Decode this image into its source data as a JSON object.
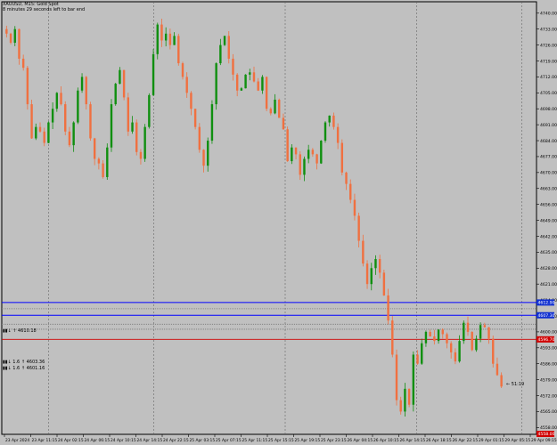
{
  "header": {
    "symbol_line": "XAUUSD, M15: Gold Spot",
    "timer_line": "8 minutes 29 seconds left to bar end"
  },
  "annotations": {
    "hline_label_1": "▮▮↓ ↑ 4610.18",
    "hline_label_2": "▮▮↓ 1.6 ↑ 4603.36",
    "hline_label_3": "▮▮↓ 1.6 ↑ 4601.16",
    "countdown": "← 51:19"
  },
  "colors": {
    "background": "#c0c0c0",
    "bull_candle": "#0f8f0f",
    "bear_candle": "#f07040",
    "grid": "#666666",
    "blue_line": "#0000ff",
    "red_line": "#d00000",
    "current_price_tag": "#d00000",
    "blue_price_tag": "#1030d0"
  },
  "chart_data": {
    "type": "candlestick",
    "symbol": "XAUUSD",
    "timeframe": "M15",
    "y_axis_ticks": [
      "4740.00",
      "4733.00",
      "4726.00",
      "4719.00",
      "4712.00",
      "4705.00",
      "4698.00",
      "4691.00",
      "4684.00",
      "4677.00",
      "4670.00",
      "4663.00",
      "4656.00",
      "4649.00",
      "4642.00",
      "4635.00",
      "4628.00",
      "4621.00",
      "4614.00",
      "4607.00",
      "4600.00",
      "4593.00",
      "4586.00",
      "4579.00",
      "4572.00",
      "4565.00",
      "4558.00"
    ],
    "x_axis_ticks": [
      "23 Apr 2024",
      "23 Apr 11:15",
      "24 Apr 02:15",
      "24 Apr 06:15",
      "24 Apr 10:15",
      "24 Apr 14:15",
      "24 Apr 22:15",
      "25 Apr 03:15",
      "25 Apr 07:15",
      "25 Apr 11:15",
      "25 Apr 15:15",
      "25 Apr 19:15",
      "25 Apr 23:15",
      "26 Apr 04:15",
      "26 Apr 10:15",
      "26 Apr 14:15",
      "26 Apr 18:15",
      "26 Apr 22:15",
      "29 Apr 01:15",
      "29 Apr 05:15",
      "29 Apr 09:15"
    ],
    "y_range": [
      4555,
      4745
    ],
    "candles_close_path": [
      4731,
      4727,
      4733,
      4720,
      4716,
      4700,
      4685,
      4690,
      4688,
      4683,
      4692,
      4698,
      4705,
      4700,
      4688,
      4682,
      4692,
      4706,
      4712,
      4700,
      4685,
      4676,
      4674,
      4668,
      4681,
      4700,
      4709,
      4715,
      4703,
      4688,
      4692,
      4679,
      4676,
      4690,
      4704,
      4722,
      4735,
      4728,
      4731,
      4726,
      4730,
      4718,
      4712,
      4705,
      4698,
      4690,
      4680,
      4673,
      4684,
      4700,
      4718,
      4726,
      4730,
      4720,
      4713,
      4706,
      4707,
      4713,
      4714,
      4710,
      4706,
      4712,
      4698,
      4696,
      4702,
      4694,
      4689,
      4675,
      4681,
      4678,
      4669,
      4676,
      4680,
      4678,
      4674,
      4684,
      4692,
      4695,
      4690,
      4683,
      4670,
      4665,
      4658,
      4651,
      4640,
      4630,
      4621,
      4628,
      4632,
      4626,
      4616,
      4605,
      4590,
      4570,
      4565,
      4575,
      4568,
      4590,
      4586,
      4595,
      4600,
      4598,
      4596,
      4601,
      4599,
      4595,
      4591,
      4587,
      4596,
      4604,
      4600,
      4592,
      4597,
      4603,
      4602,
      4597,
      4586,
      4581,
      4576
    ],
    "horizontal_lines": [
      {
        "price": 4603.36,
        "style": "dotted",
        "color": "gray"
      },
      {
        "price": 4601.16,
        "style": "dotted",
        "color": "gray"
      },
      {
        "price": 4610.18,
        "style": "dotted",
        "color": "gray"
      },
      {
        "price": 4612.9,
        "style": "solid",
        "color": "blue",
        "tag": "4612.90"
      },
      {
        "price": 4607.3,
        "style": "solid",
        "color": "blue",
        "tag": "4607.30"
      },
      {
        "price": 4596.7,
        "style": "solid",
        "color": "red",
        "tag": "4596.70"
      }
    ],
    "current_price_tag": "4596.70",
    "bottom_tag": "4558.00",
    "vertical_separators_at_tick_index": [
      1,
      5,
      10,
      15,
      19
    ]
  }
}
